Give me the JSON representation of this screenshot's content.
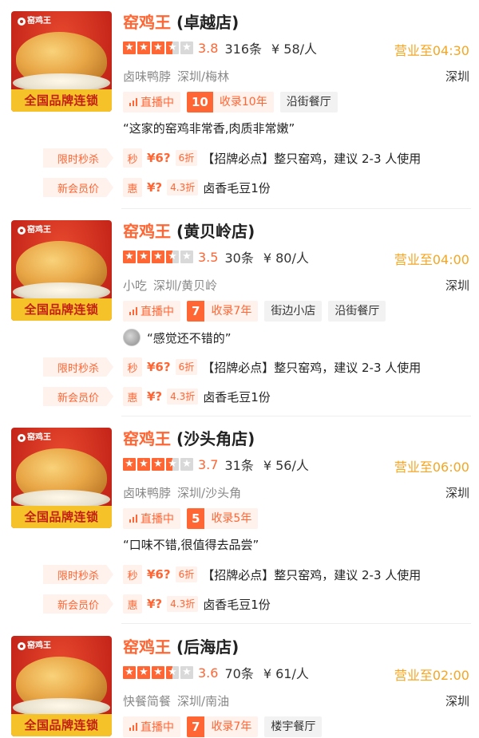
{
  "thumbnail": {
    "logo_text": "窑鸡王",
    "banner_text": "全国品牌连锁"
  },
  "deal_labels": {
    "flash": "限时秒杀",
    "new_member": "新会员价",
    "flash_mark": "秒",
    "member_mark": "惠"
  },
  "colors": {
    "accent": "#ff6633",
    "open_hours": "#f5a623",
    "banner": "#f6c22a"
  },
  "stores": [
    {
      "brand": "窑鸡王",
      "branch": "(卓越店)",
      "stars": [
        "full",
        "full",
        "full",
        "half",
        "empty"
      ],
      "score": "3.8",
      "reviews": "316条",
      "avg_price": "¥ 58/人",
      "open_until": "营业至04:30",
      "category": "卤味鸭脖",
      "area": "深圳/梅林",
      "city": "深圳",
      "live": "直播中",
      "years_num": "10",
      "years_label": "收录10年",
      "tags": [
        "沿街餐厅"
      ],
      "quote": "“这家的窑鸡非常香,肉质非常嫩”",
      "quote_avatar": false,
      "flash_price": "¥6?",
      "flash_disc": "6折",
      "flash_desc": "【招牌必点】整只窑鸡，建议 2-3 人使用",
      "member_price": "¥?",
      "member_disc": "4.3折",
      "member_desc": "卤香毛豆1份"
    },
    {
      "brand": "窑鸡王",
      "branch": "(黄贝岭店)",
      "stars": [
        "full",
        "full",
        "full",
        "half",
        "empty"
      ],
      "score": "3.5",
      "reviews": "30条",
      "avg_price": "¥ 80/人",
      "open_until": "营业至04:00",
      "category": "小吃",
      "area": "深圳/黄贝岭",
      "city": "深圳",
      "live": "直播中",
      "years_num": "7",
      "years_label": "收录7年",
      "tags": [
        "街边小店",
        "沿街餐厅"
      ],
      "quote": "“感觉还不错的”",
      "quote_avatar": true,
      "flash_price": "¥6?",
      "flash_disc": "6折",
      "flash_desc": "【招牌必点】整只窑鸡，建议 2-3 人使用",
      "member_price": "¥?",
      "member_disc": "4.3折",
      "member_desc": "卤香毛豆1份"
    },
    {
      "brand": "窑鸡王",
      "branch": "(沙头角店)",
      "stars": [
        "full",
        "full",
        "full",
        "half",
        "empty"
      ],
      "score": "3.7",
      "reviews": "31条",
      "avg_price": "¥ 56/人",
      "open_until": "营业至06:00",
      "category": "卤味鸭脖",
      "area": "深圳/沙头角",
      "city": "深圳",
      "live": "直播中",
      "years_num": "5",
      "years_label": "收录5年",
      "tags": [],
      "quote": "“口味不错,很值得去品尝”",
      "quote_avatar": false,
      "flash_price": "¥6?",
      "flash_disc": "6折",
      "flash_desc": "【招牌必点】整只窑鸡，建议 2-3 人使用",
      "member_price": "¥?",
      "member_disc": "4.3折",
      "member_desc": "卤香毛豆1份"
    },
    {
      "brand": "窑鸡王",
      "branch": "(后海店)",
      "stars": [
        "full",
        "full",
        "full",
        "half",
        "empty"
      ],
      "score": "3.6",
      "reviews": "70条",
      "avg_price": "¥ 61/人",
      "open_until": "营业至02:00",
      "category": "快餐简餐",
      "area": "深圳/南油",
      "city": "深圳",
      "live": "直播中",
      "years_num": "7",
      "years_label": "收录7年",
      "tags": [
        "楼宇餐厅"
      ]
    }
  ]
}
